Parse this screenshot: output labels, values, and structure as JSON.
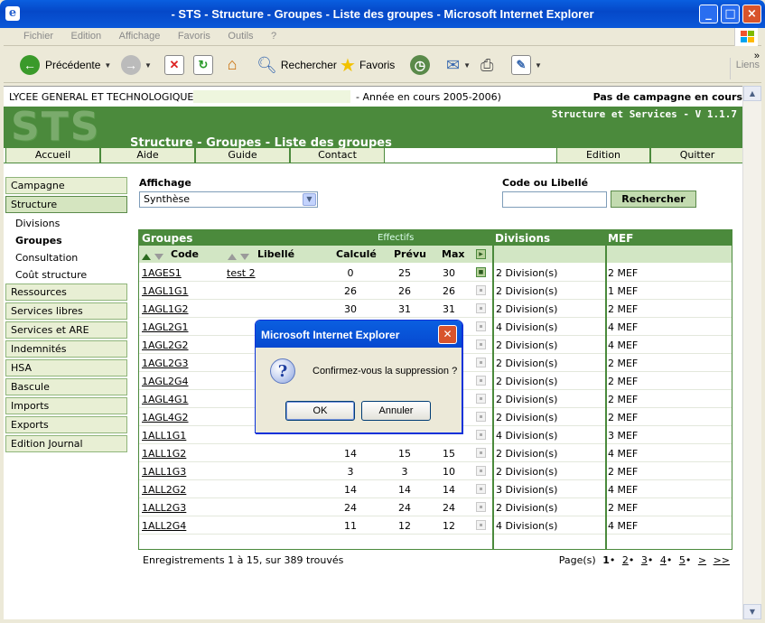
{
  "window": {
    "title": "- STS - Structure - Groupes - Liste des groupes - Microsoft Internet Explorer",
    "min_glyph": "_",
    "max_glyph": "□",
    "close_glyph": "×"
  },
  "menu": [
    "Fichier",
    "Edition",
    "Affichage",
    "Favoris",
    "Outils",
    "?"
  ],
  "toolbar": {
    "back_label": "Précédente",
    "search_label": "Rechercher",
    "favorites_label": "Favoris",
    "liens_label": "Liens",
    "chevron": "»"
  },
  "school": {
    "name": "LYCEE GENERAL ET TECHNOLOGIQUE",
    "year": "- Année en cours 2005-2006)",
    "campaign": "Pas de campagne en cours"
  },
  "banner": {
    "logo_text": "STS",
    "app_name": "Structure et Services - V 1.1.7",
    "page_title": "Structure - Groupes - Liste des groupes"
  },
  "topnav": {
    "left": [
      "Accueil",
      "Aide",
      "Guide",
      "Contact"
    ],
    "right": [
      "Edition",
      "Quitter"
    ]
  },
  "sidebar": {
    "campagne": "Campagne",
    "structure": "Structure",
    "sub": [
      "Divisions",
      "Groupes",
      "Consultation",
      "Coût structure"
    ],
    "items": [
      "Ressources",
      "Services libres",
      "Services et ARE",
      "Indemnités",
      "HSA",
      "Bascule",
      "Imports",
      "Exports",
      "Edition Journal"
    ]
  },
  "filters": {
    "affichage_label": "Affichage",
    "affichage_value": "Synthèse",
    "code_label": "Code ou Libellé",
    "code_value": "",
    "search_button": "Rechercher"
  },
  "table": {
    "groupes_header": "Groupes",
    "effectifs_header": "Effectifs",
    "divisions_header": "Divisions",
    "mef_header": "MEF",
    "col_code": "Code",
    "col_libelle": "Libellé",
    "col_calcule": "Calculé",
    "col_prevu": "Prévu",
    "col_max": "Max",
    "rows": [
      {
        "code": "1AGES1",
        "libelle": "test 2",
        "calcule": "0",
        "prevu": "25",
        "max": "30",
        "divisions": "2 Division(s)",
        "mef": "2 MEF",
        "checked": true
      },
      {
        "code": "1AGL1G1",
        "libelle": "",
        "calcule": "26",
        "prevu": "26",
        "max": "26",
        "divisions": "2 Division(s)",
        "mef": "1 MEF",
        "checked": false
      },
      {
        "code": "1AGL1G2",
        "libelle": "",
        "calcule": "30",
        "prevu": "31",
        "max": "31",
        "divisions": "2 Division(s)",
        "mef": "2 MEF",
        "checked": false
      },
      {
        "code": "1AGL2G1",
        "libelle": "",
        "calcule": "",
        "prevu": "",
        "max": "",
        "divisions": "4 Division(s)",
        "mef": "4 MEF",
        "checked": false
      },
      {
        "code": "1AGL2G2",
        "libelle": "",
        "calcule": "",
        "prevu": "",
        "max": "",
        "divisions": "2 Division(s)",
        "mef": "4 MEF",
        "checked": false
      },
      {
        "code": "1AGL2G3",
        "libelle": "",
        "calcule": "",
        "prevu": "",
        "max": "",
        "divisions": "2 Division(s)",
        "mef": "2 MEF",
        "checked": false
      },
      {
        "code": "1AGL2G4",
        "libelle": "",
        "calcule": "",
        "prevu": "",
        "max": "",
        "divisions": "2 Division(s)",
        "mef": "2 MEF",
        "checked": false
      },
      {
        "code": "1AGL4G1",
        "libelle": "",
        "calcule": "",
        "prevu": "",
        "max": "",
        "divisions": "2 Division(s)",
        "mef": "2 MEF",
        "checked": false
      },
      {
        "code": "1AGL4G2",
        "libelle": "",
        "calcule": "",
        "prevu": "",
        "max": "",
        "divisions": "2 Division(s)",
        "mef": "2 MEF",
        "checked": false
      },
      {
        "code": "1ALL1G1",
        "libelle": "",
        "calcule": "",
        "prevu": "",
        "max": "",
        "divisions": "4 Division(s)",
        "mef": "3 MEF",
        "checked": false
      },
      {
        "code": "1ALL1G2",
        "libelle": "",
        "calcule": "14",
        "prevu": "15",
        "max": "15",
        "divisions": "2 Division(s)",
        "mef": "4 MEF",
        "checked": false
      },
      {
        "code": "1ALL1G3",
        "libelle": "",
        "calcule": "3",
        "prevu": "3",
        "max": "10",
        "divisions": "2 Division(s)",
        "mef": "2 MEF",
        "checked": false
      },
      {
        "code": "1ALL2G2",
        "libelle": "",
        "calcule": "14",
        "prevu": "14",
        "max": "14",
        "divisions": "3 Division(s)",
        "mef": "4 MEF",
        "checked": false
      },
      {
        "code": "1ALL2G3",
        "libelle": "",
        "calcule": "24",
        "prevu": "24",
        "max": "24",
        "divisions": "2 Division(s)",
        "mef": "2 MEF",
        "checked": false
      },
      {
        "code": "1ALL2G4",
        "libelle": "",
        "calcule": "11",
        "prevu": "12",
        "max": "12",
        "divisions": "4 Division(s)",
        "mef": "4 MEF",
        "checked": false
      }
    ]
  },
  "footer": {
    "records": "Enregistrements 1 à 15, sur 389 trouvés",
    "pages_label": "Page(s)",
    "pages": [
      "1",
      "2",
      "3",
      "4",
      "5"
    ],
    "next": ">",
    "last": ">>"
  },
  "dialog": {
    "title": "Microsoft Internet Explorer",
    "message": "Confirmez-vous la suppression ?",
    "ok": "OK",
    "cancel": "Annuler",
    "icon_glyph": "?"
  },
  "colors": {
    "brand_green": "#4b8a3c",
    "light_green": "#e8efd4",
    "xp_blue": "#0548c8"
  }
}
